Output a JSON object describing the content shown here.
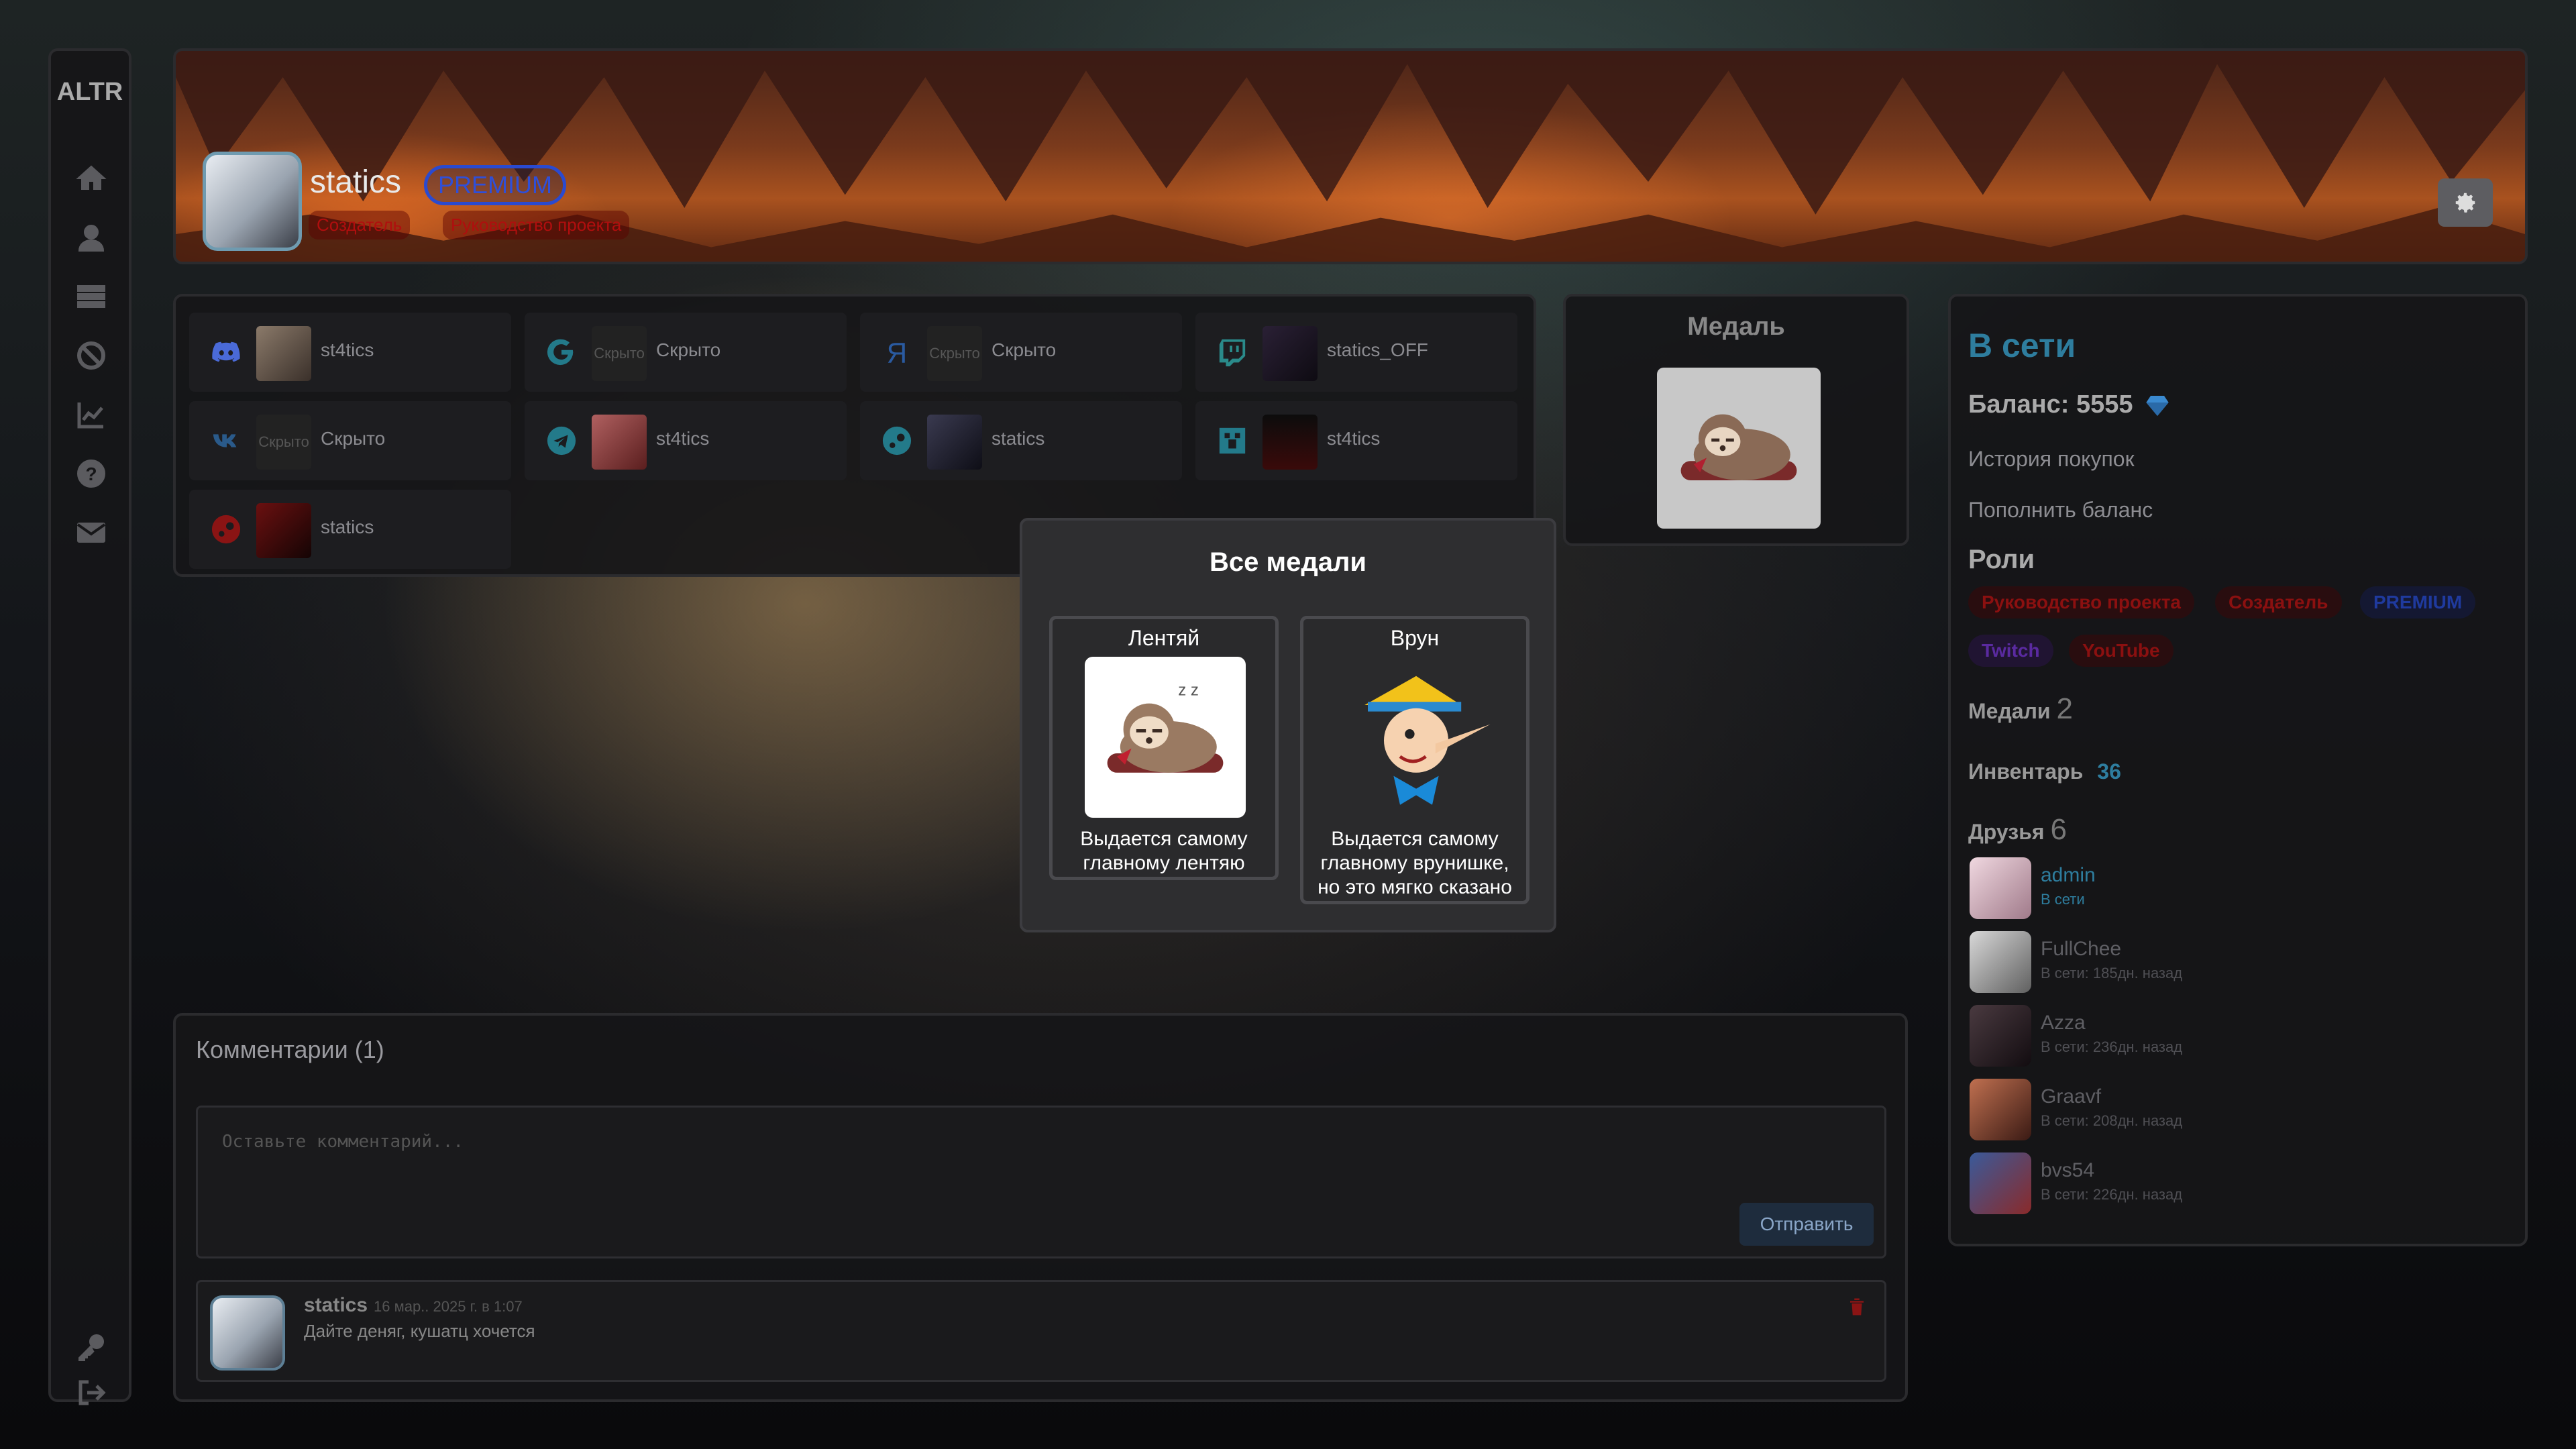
{
  "app": {
    "brand": "ALTR"
  },
  "sidebar": {
    "icons": [
      "home-icon",
      "user-icon",
      "list-icon",
      "ban-icon",
      "chart-icon",
      "help-icon",
      "mail-icon",
      "key-icon",
      "logout-icon"
    ]
  },
  "profile": {
    "username": "statics",
    "premium_label": "PREMIUM",
    "role_tags": [
      "Создатель",
      "Руководство проекта"
    ]
  },
  "socials": [
    {
      "icon": "discord-icon",
      "name": "st4tics",
      "hidden_label": ""
    },
    {
      "icon": "google-icon",
      "name": "Скрыто",
      "hidden_label": "Скрыто"
    },
    {
      "icon": "yandex-icon",
      "name": "Скрыто",
      "hidden_label": "Скрыто"
    },
    {
      "icon": "twitch-icon",
      "name": "statics_OFF",
      "hidden_label": ""
    },
    {
      "icon": "vk-icon",
      "name": "Скрыто",
      "hidden_label": "Скрыто"
    },
    {
      "icon": "telegram-icon",
      "name": "st4tics",
      "hidden_label": ""
    },
    {
      "icon": "steam-icon",
      "name": "statics",
      "hidden_label": ""
    },
    {
      "icon": "minecraft-icon",
      "name": "st4tics",
      "hidden_label": ""
    },
    {
      "icon": "steam-red-icon",
      "name": "statics",
      "hidden_label": ""
    }
  ],
  "medal_card": {
    "title": "Медаль"
  },
  "right_panel": {
    "online_title": "В сети",
    "balance_label": "Баланс: 5555",
    "purchase_history": "История покупок",
    "top_up": "Пополнить баланс",
    "roles_title": "Роли",
    "roles": [
      {
        "label": "Руководство проекта",
        "color": "#8b1010"
      },
      {
        "label": "Создатель",
        "color": "#8b1010"
      },
      {
        "label": "PREMIUM",
        "color": "#1f3a9e"
      },
      {
        "label": "Twitch",
        "color": "#5a2aa0"
      },
      {
        "label": "YouTube",
        "color": "#8b1010"
      }
    ],
    "medals_label": "Медали",
    "medals_count": "2",
    "inventory_label": "Инвентарь",
    "inventory_count": "36",
    "friends_label": "Друзья",
    "friends_count": "6",
    "friends": [
      {
        "name": "admin",
        "status": "В сети"
      },
      {
        "name": "FullChee",
        "status": "В сети: 185дн. назад"
      },
      {
        "name": "Azza",
        "status": "В сети: 236дн. назад"
      },
      {
        "name": "Graavf",
        "status": "В сети: 208дн. назад"
      },
      {
        "name": "bvs54",
        "status": "В сети: 226дн. назад"
      }
    ]
  },
  "comments": {
    "title": "Комментарии (1)",
    "placeholder": "Оставьте комментарий...",
    "send_label": "Отправить",
    "items": [
      {
        "author": "statics",
        "date": "16 мар.. 2025 г. в 1:07",
        "text": "Дайте деняг, кушатц хочется"
      }
    ]
  },
  "modal": {
    "title": "Все медали",
    "medals": [
      {
        "name": "Лентяй",
        "description": "Выдается самому главному лентяю"
      },
      {
        "name": "Врун",
        "description": "Выдается самому главному врунишке, но это мягко сказано"
      }
    ]
  }
}
